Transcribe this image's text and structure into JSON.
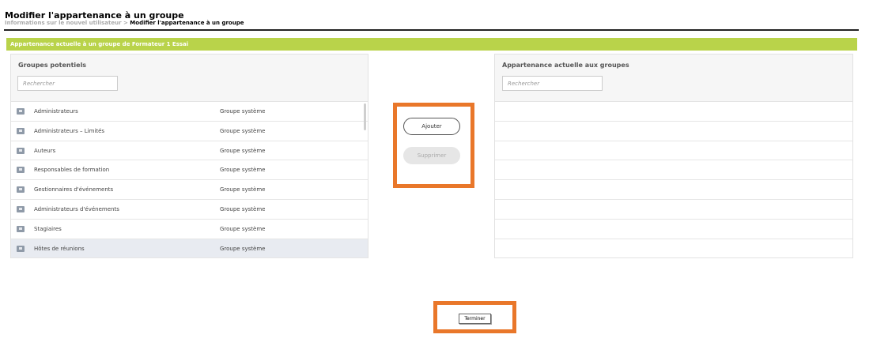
{
  "header": {
    "title": "Modifier l'appartenance à un groupe",
    "breadcrumb_prev": "Informations sur le nouvel utilisateur",
    "breadcrumb_sep": " > ",
    "breadcrumb_current": "Modifier l'appartenance à un groupe"
  },
  "banner": "Appartenance actuelle à un groupe de Formateur 1 Essai",
  "left_panel": {
    "title": "Groupes potentiels",
    "search_placeholder": "Rechercher",
    "rows": [
      {
        "name": "Administrateurs",
        "type": "Groupe système"
      },
      {
        "name": "Administrateurs – Limités",
        "type": "Groupe système"
      },
      {
        "name": "Auteurs",
        "type": "Groupe système"
      },
      {
        "name": "Responsables de formation",
        "type": "Groupe système"
      },
      {
        "name": "Gestionnaires d'événements",
        "type": "Groupe système"
      },
      {
        "name": "Administrateurs d'événements",
        "type": "Groupe système"
      },
      {
        "name": "Stagiaires",
        "type": "Groupe système"
      },
      {
        "name": "Hôtes de réunions",
        "type": "Groupe système"
      }
    ]
  },
  "right_panel": {
    "title": "Appartenance actuelle aux groupes",
    "search_placeholder": "Rechercher"
  },
  "actions": {
    "add_label": "Ajouter",
    "remove_label": "Supprimer",
    "done_label": "Terminer"
  },
  "colors": {
    "banner": "#b9d34a",
    "highlight": "#e9772a"
  }
}
